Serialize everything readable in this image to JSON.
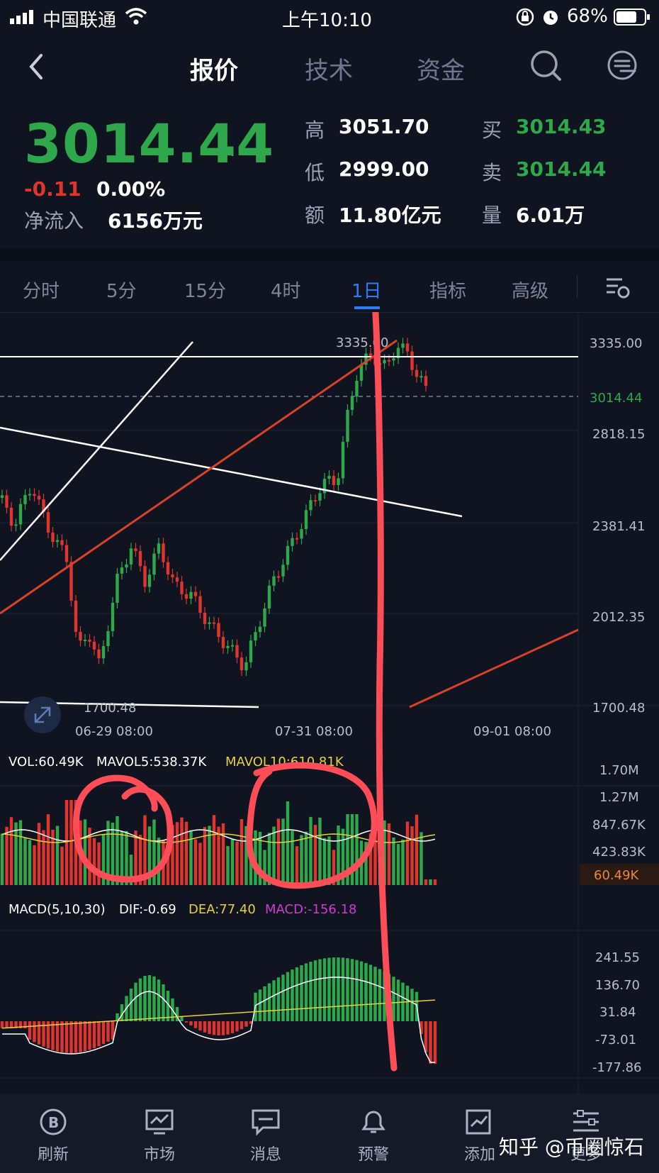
{
  "status_bar": {
    "carrier": "中国联通",
    "time": "上午10:10",
    "battery": "68%"
  },
  "nav": {
    "tabs": [
      "报价",
      "技术",
      "资金"
    ]
  },
  "quote": {
    "price": "3014.44",
    "change": "-0.11",
    "change_pct": "0.00%",
    "net_inflow_label": "净流入",
    "net_inflow": "6156万元",
    "high_label": "高",
    "high": "3051.70",
    "low_label": "低",
    "low": "2999.00",
    "amount_label": "额",
    "amount": "11.80亿元",
    "bid_label": "买",
    "bid": "3014.43",
    "ask_label": "卖",
    "ask": "3014.44",
    "volume_label": "量",
    "volume": "6.01万"
  },
  "periods": [
    "分时",
    "5分",
    "15分",
    "4时",
    "1日",
    "指标",
    "高级"
  ],
  "price_chart": {
    "y_ticks": [
      "3335.00",
      "2818.15",
      "2381.41",
      "2012.35",
      "1700.48"
    ],
    "current_price_tag": "3014.44",
    "max_label": "3335.00",
    "min_label": "1700.48",
    "x_ticks": [
      "06-29 08:00",
      "07-31 08:00",
      "09-01 08:00"
    ]
  },
  "volume_chart": {
    "vol_label": "VOL:60.49K",
    "mavol5_label": "MAVOL5:538.37K",
    "mavol10_label": "MAVOL10:610.81K",
    "y_ticks": [
      "1.70M",
      "1.27M",
      "847.67K",
      "423.83K"
    ],
    "current_tag": "60.49K"
  },
  "macd_chart": {
    "title_label": "MACD(5,10,30)",
    "dif_label": "DIF:-0.69",
    "dea_label": "DEA:77.40",
    "macd_label": "MACD:-156.18",
    "y_ticks": [
      "241.55",
      "136.70",
      "31.84",
      "-73.01",
      "-177.86"
    ]
  },
  "bottom_bar": {
    "items": [
      "刷新",
      "市场",
      "消息",
      "预警",
      "添加",
      "更多"
    ],
    "watermark": "知乎 @币圈惊石"
  },
  "colors": {
    "up": "#2ea84a",
    "down": "#e0342f",
    "accent": "#2f7df0",
    "annotation": "#ff4d57"
  }
}
